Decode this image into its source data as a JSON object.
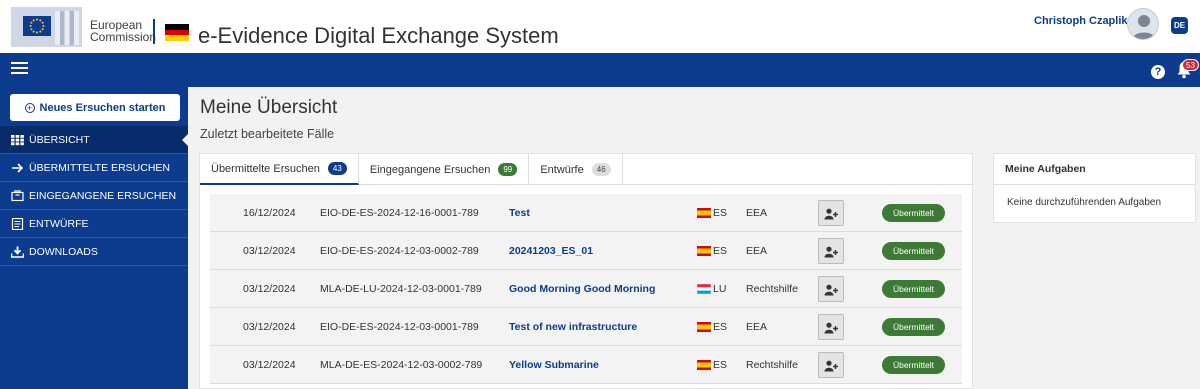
{
  "header": {
    "org_line1": "European",
    "org_line2": "Commission",
    "app_title": "e-Evidence Digital Exchange System",
    "user_name": "Christoph Czaplik",
    "language": "DE"
  },
  "navbar": {
    "help_label": "?",
    "notifications_count": "53"
  },
  "sidebar": {
    "new_request_label": "Neues Ersuchen starten",
    "items": [
      {
        "label": "ÜBERSICHT",
        "icon": "grid-icon",
        "active": true
      },
      {
        "label": "ÜBERMITTELTE ERSUCHEN",
        "icon": "arrow-right-icon"
      },
      {
        "label": "EINGEGANGENE ERSUCHEN",
        "icon": "inbox-icon"
      },
      {
        "label": "ENTWÜRFE",
        "icon": "document-icon"
      },
      {
        "label": "DOWNLOADS",
        "icon": "download-icon"
      }
    ]
  },
  "main": {
    "title": "Meine Übersicht",
    "subtitle": "Zuletzt bearbeitete Fälle",
    "tabs": [
      {
        "label": "Übermittelte Ersuchen",
        "count": "43",
        "active": true
      },
      {
        "label": "Eingegangene Ersuchen",
        "count": "99"
      },
      {
        "label": "Entwürfe",
        "count": "46"
      }
    ],
    "rows": [
      {
        "date": "16/12/2024",
        "reference": "EIO-DE-ES-2024-12-16-0001-789",
        "title": "Test",
        "country": "ES",
        "type": "EEA",
        "status": "Übermittelt"
      },
      {
        "date": "03/12/2024",
        "reference": "EIO-DE-ES-2024-12-03-0002-789",
        "title": "20241203_ES_01",
        "country": "ES",
        "type": "EEA",
        "status": "Übermittelt"
      },
      {
        "date": "03/12/2024",
        "reference": "MLA-DE-LU-2024-12-03-0001-789",
        "title": "Good Morning Good Morning",
        "country": "LU",
        "type": "Rechtshilfe",
        "status": "Übermittelt"
      },
      {
        "date": "03/12/2024",
        "reference": "EIO-DE-ES-2024-12-03-0001-789",
        "title": "Test of new infrastructure",
        "country": "ES",
        "type": "EEA",
        "status": "Übermittelt"
      },
      {
        "date": "03/12/2024",
        "reference": "MLA-DE-ES-2024-12-03-0002-789",
        "title": "Yellow Submarine",
        "country": "ES",
        "type": "Rechtshilfe",
        "status": "Übermittelt"
      }
    ]
  },
  "tasks": {
    "title": "Meine Aufgaben",
    "empty_text": "Keine durchzuführenden Aufgaben"
  },
  "colors": {
    "primary": "#0d3b8e",
    "status_green": "#3d7a35",
    "badge_red": "#d0263b"
  }
}
